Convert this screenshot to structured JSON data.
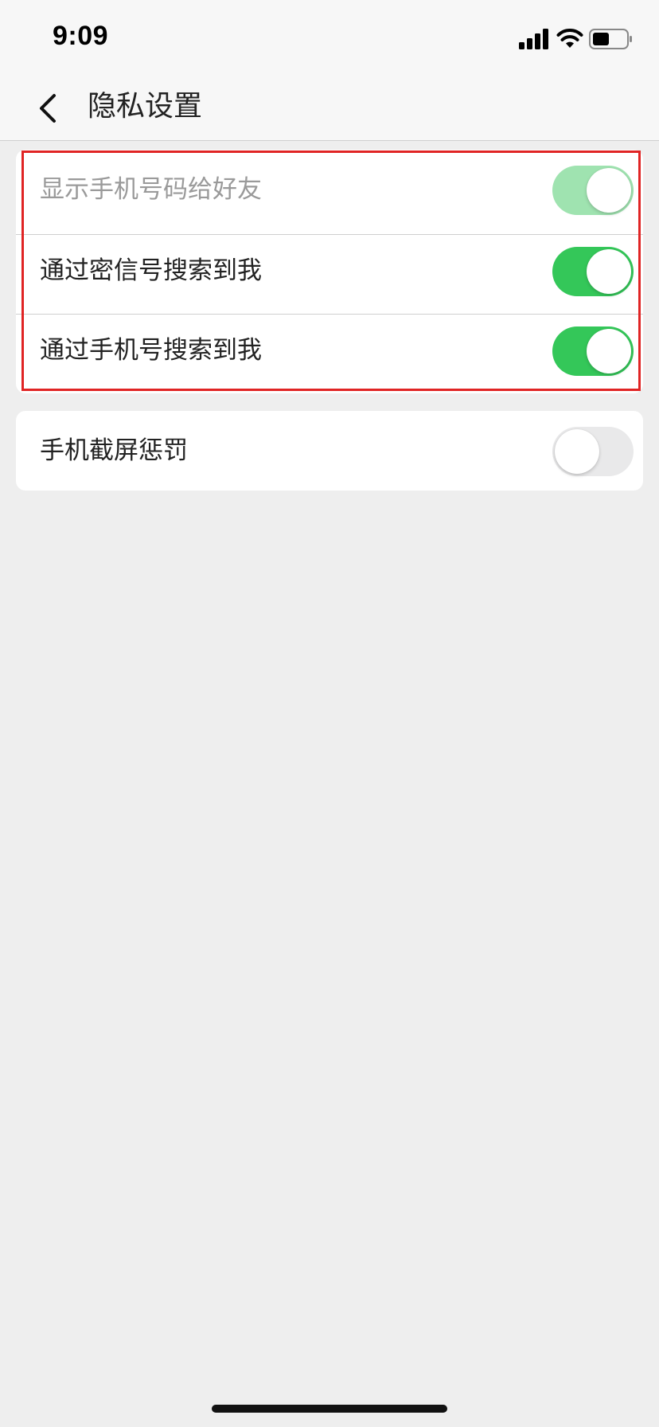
{
  "status_bar": {
    "time": "9:09",
    "icons": [
      "cellular-signal-icon",
      "wifi-icon",
      "battery-icon"
    ]
  },
  "nav": {
    "back_icon": "chevron-left-icon",
    "title": "隐私设置"
  },
  "settings": {
    "group1": [
      {
        "label": "显示手机号码给好友",
        "enabled": false,
        "on": true
      },
      {
        "label": "通过密信号搜索到我",
        "enabled": true,
        "on": true
      },
      {
        "label": "通过手机号搜索到我",
        "enabled": true,
        "on": true
      }
    ],
    "group2": [
      {
        "label": "手机截屏惩罚",
        "enabled": true,
        "on": false
      }
    ]
  },
  "colors": {
    "toggle_on": "#34c759",
    "toggle_on_disabled": "#9fe3b0",
    "toggle_off": "#e9e9ea",
    "highlight_border": "#e02424",
    "background": "#eeeeee"
  }
}
